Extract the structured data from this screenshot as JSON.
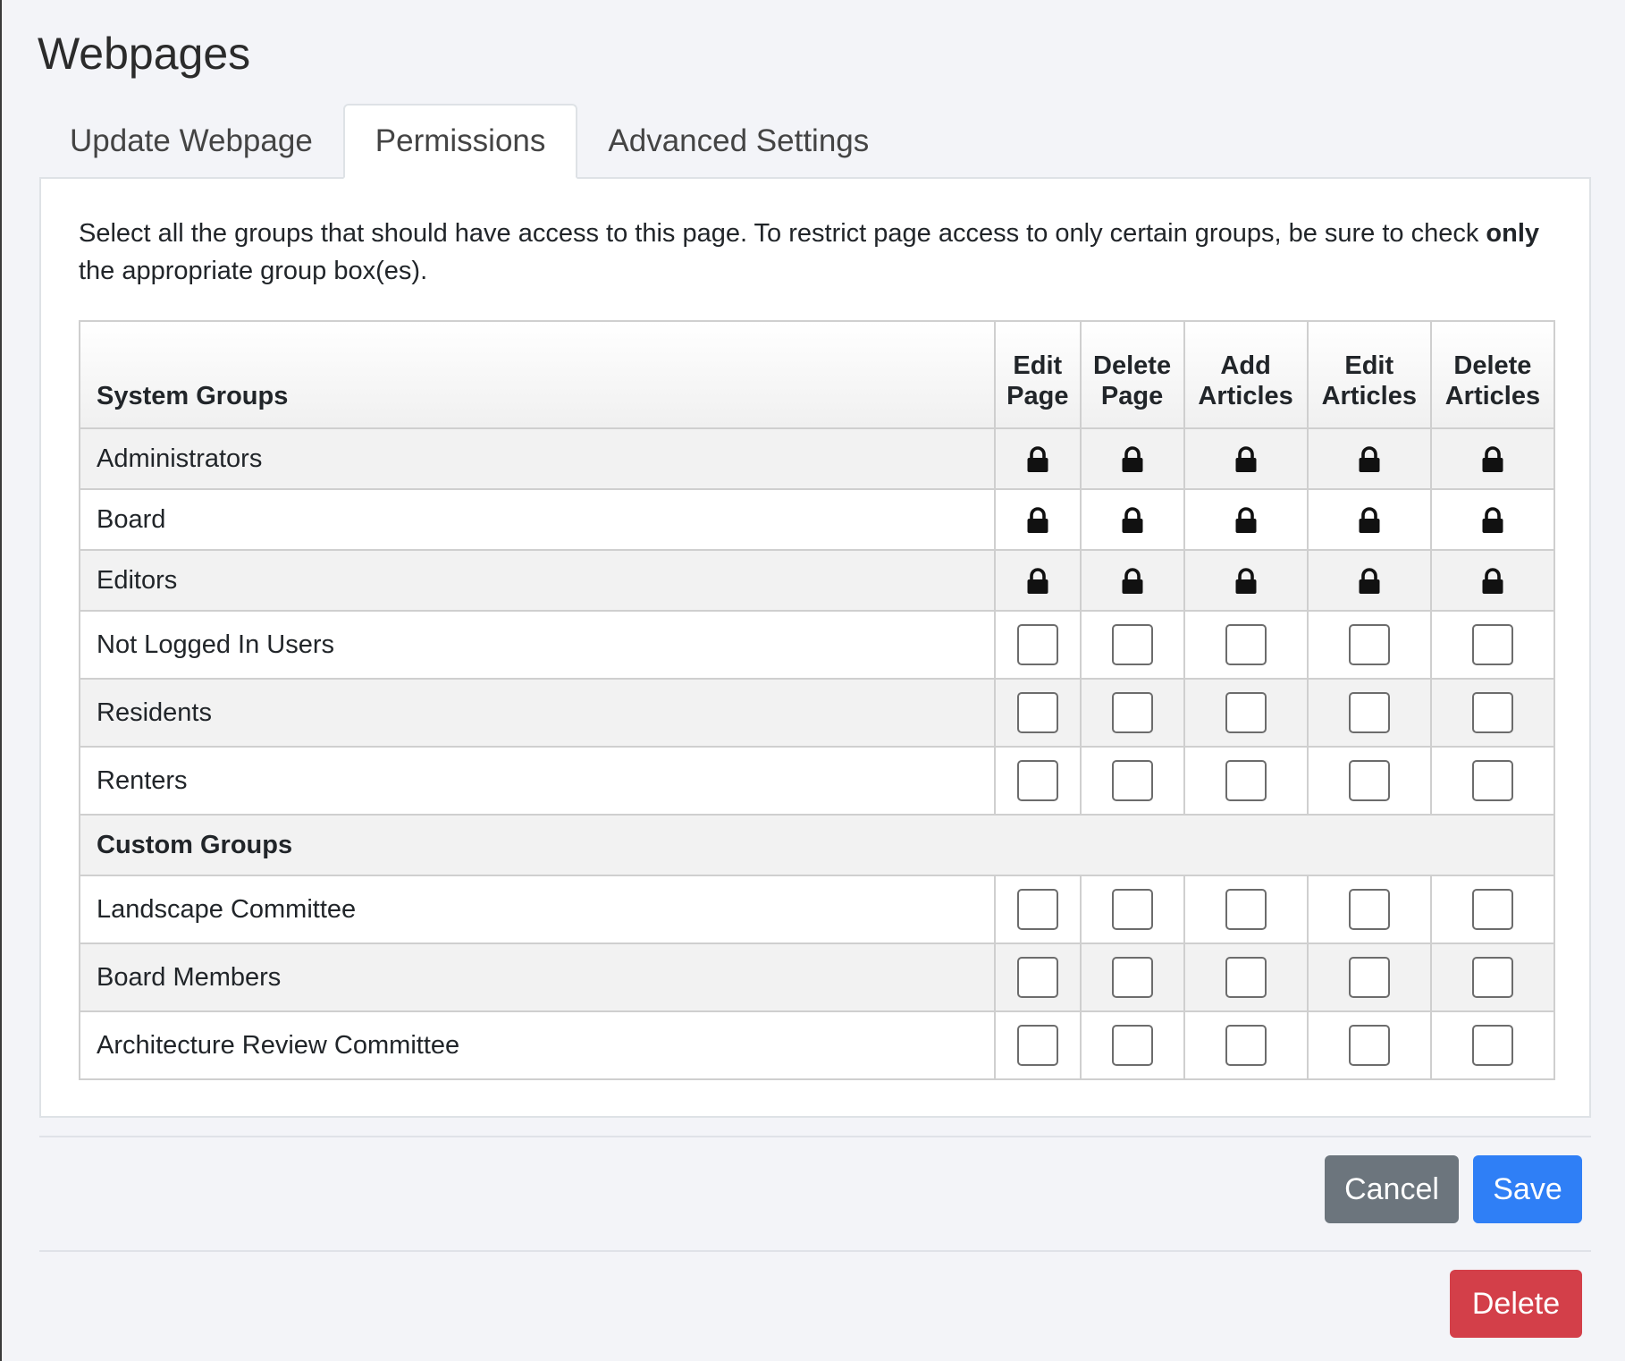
{
  "page": {
    "title": "Webpages"
  },
  "tabs": [
    {
      "label": "Update Webpage",
      "active": false
    },
    {
      "label": "Permissions",
      "active": true
    },
    {
      "label": "Advanced Settings",
      "active": false
    }
  ],
  "intro": {
    "text_before": "Select all the groups that should have access to this page. To restrict page access to only certain groups, be sure to check ",
    "emphasis": "only",
    "text_after": " the appropriate group box(es)."
  },
  "table": {
    "group_header": "System Groups",
    "columns": [
      {
        "line1": "Edit",
        "line2": "Page"
      },
      {
        "line1": "Delete",
        "line2": "Page"
      },
      {
        "line1": "Add",
        "line2": "Articles"
      },
      {
        "line1": "Edit",
        "line2": "Articles"
      },
      {
        "line1": "Delete",
        "line2": "Articles"
      }
    ],
    "system_groups": [
      {
        "name": "Administrators",
        "locked": true
      },
      {
        "name": "Board",
        "locked": true
      },
      {
        "name": "Editors",
        "locked": true
      },
      {
        "name": "Not Logged In Users",
        "locked": false
      },
      {
        "name": "Residents",
        "locked": false
      },
      {
        "name": "Renters",
        "locked": false
      }
    ],
    "custom_header": "Custom Groups",
    "custom_groups": [
      {
        "name": "Landscape Committee",
        "locked": false
      },
      {
        "name": "Board Members",
        "locked": false
      },
      {
        "name": "Architecture Review Committee",
        "locked": false
      }
    ]
  },
  "buttons": {
    "cancel": "Cancel",
    "save": "Save",
    "delete": "Delete"
  },
  "icons": {
    "lock": "lock-icon"
  },
  "colors": {
    "cancel": "#6c757d",
    "save": "#2f7ff6",
    "delete": "#d33f49"
  }
}
